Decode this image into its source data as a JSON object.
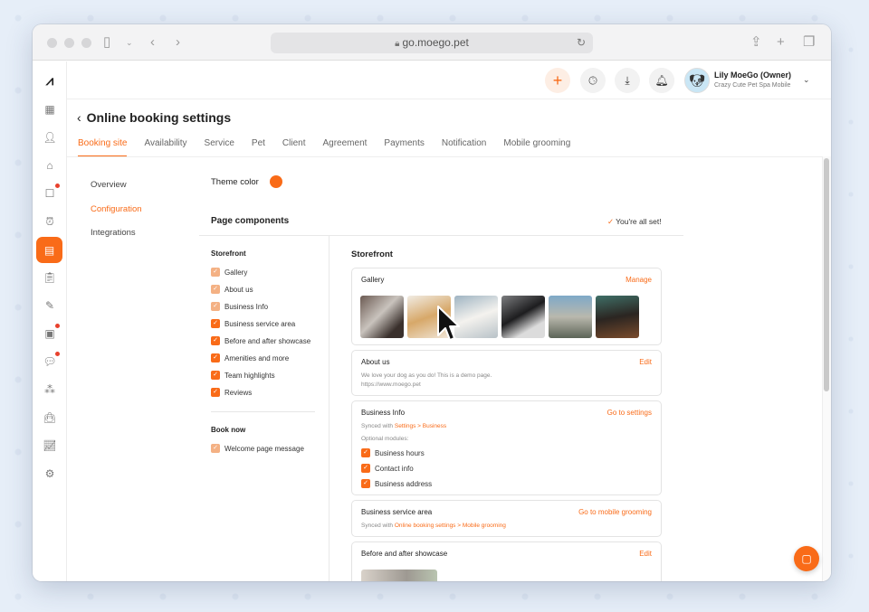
{
  "browser": {
    "url": "go.moego.pet"
  },
  "topbar": {
    "user_name": "Lily MoeGo (Owner)",
    "business_name": "Crazy Cute Pet Spa Mobile"
  },
  "page": {
    "title": "Online booking settings",
    "tabs": [
      {
        "label": "Booking site",
        "active": true
      },
      {
        "label": "Availability"
      },
      {
        "label": "Service"
      },
      {
        "label": "Pet"
      },
      {
        "label": "Client"
      },
      {
        "label": "Agreement"
      },
      {
        "label": "Payments"
      },
      {
        "label": "Notification"
      },
      {
        "label": "Mobile grooming"
      }
    ]
  },
  "subnav": {
    "items": [
      {
        "label": "Overview"
      },
      {
        "label": "Configuration",
        "active": true
      },
      {
        "label": "Integrations"
      }
    ]
  },
  "theme": {
    "label": "Theme color",
    "color": "#f96b18"
  },
  "components": {
    "title": "Page components",
    "status": "You're all set!",
    "storefront_heading": "Storefront",
    "storefront_items": [
      {
        "label": "Gallery",
        "checked": true,
        "locked": true
      },
      {
        "label": "About us",
        "checked": true,
        "locked": true
      },
      {
        "label": "Business Info",
        "checked": true,
        "locked": true
      },
      {
        "label": "Business service area",
        "checked": true
      },
      {
        "label": "Before and after showcase",
        "checked": true
      },
      {
        "label": "Amenities and more",
        "checked": true
      },
      {
        "label": "Team highlights",
        "checked": true
      },
      {
        "label": "Reviews",
        "checked": true
      }
    ],
    "book_now_heading": "Book now",
    "book_now_items": [
      {
        "label": "Welcome page message",
        "checked": true,
        "locked": true
      }
    ]
  },
  "storefront": {
    "title": "Storefront",
    "gallery": {
      "title": "Gallery",
      "action": "Manage"
    },
    "about": {
      "title": "About us",
      "action": "Edit",
      "text": "We love your dog as you do! This is a demo page.",
      "url": "https://www.moego.pet"
    },
    "business_info": {
      "title": "Business Info",
      "action": "Go to settings",
      "synced_prefix": "Synced with",
      "synced_link": "Settings > Business",
      "optional_label": "Optional modules:",
      "modules": [
        "Business hours",
        "Contact info",
        "Business address"
      ]
    },
    "service_area": {
      "title": "Business service area",
      "action": "Go to mobile grooming",
      "synced_prefix": "Synced with",
      "synced_link": "Online booking settings > Mobile grooming"
    },
    "showcase": {
      "title": "Before and after showcase",
      "action": "Edit"
    }
  },
  "colors": {
    "accent": "#f96b18",
    "accent_light": "#f4b184"
  }
}
